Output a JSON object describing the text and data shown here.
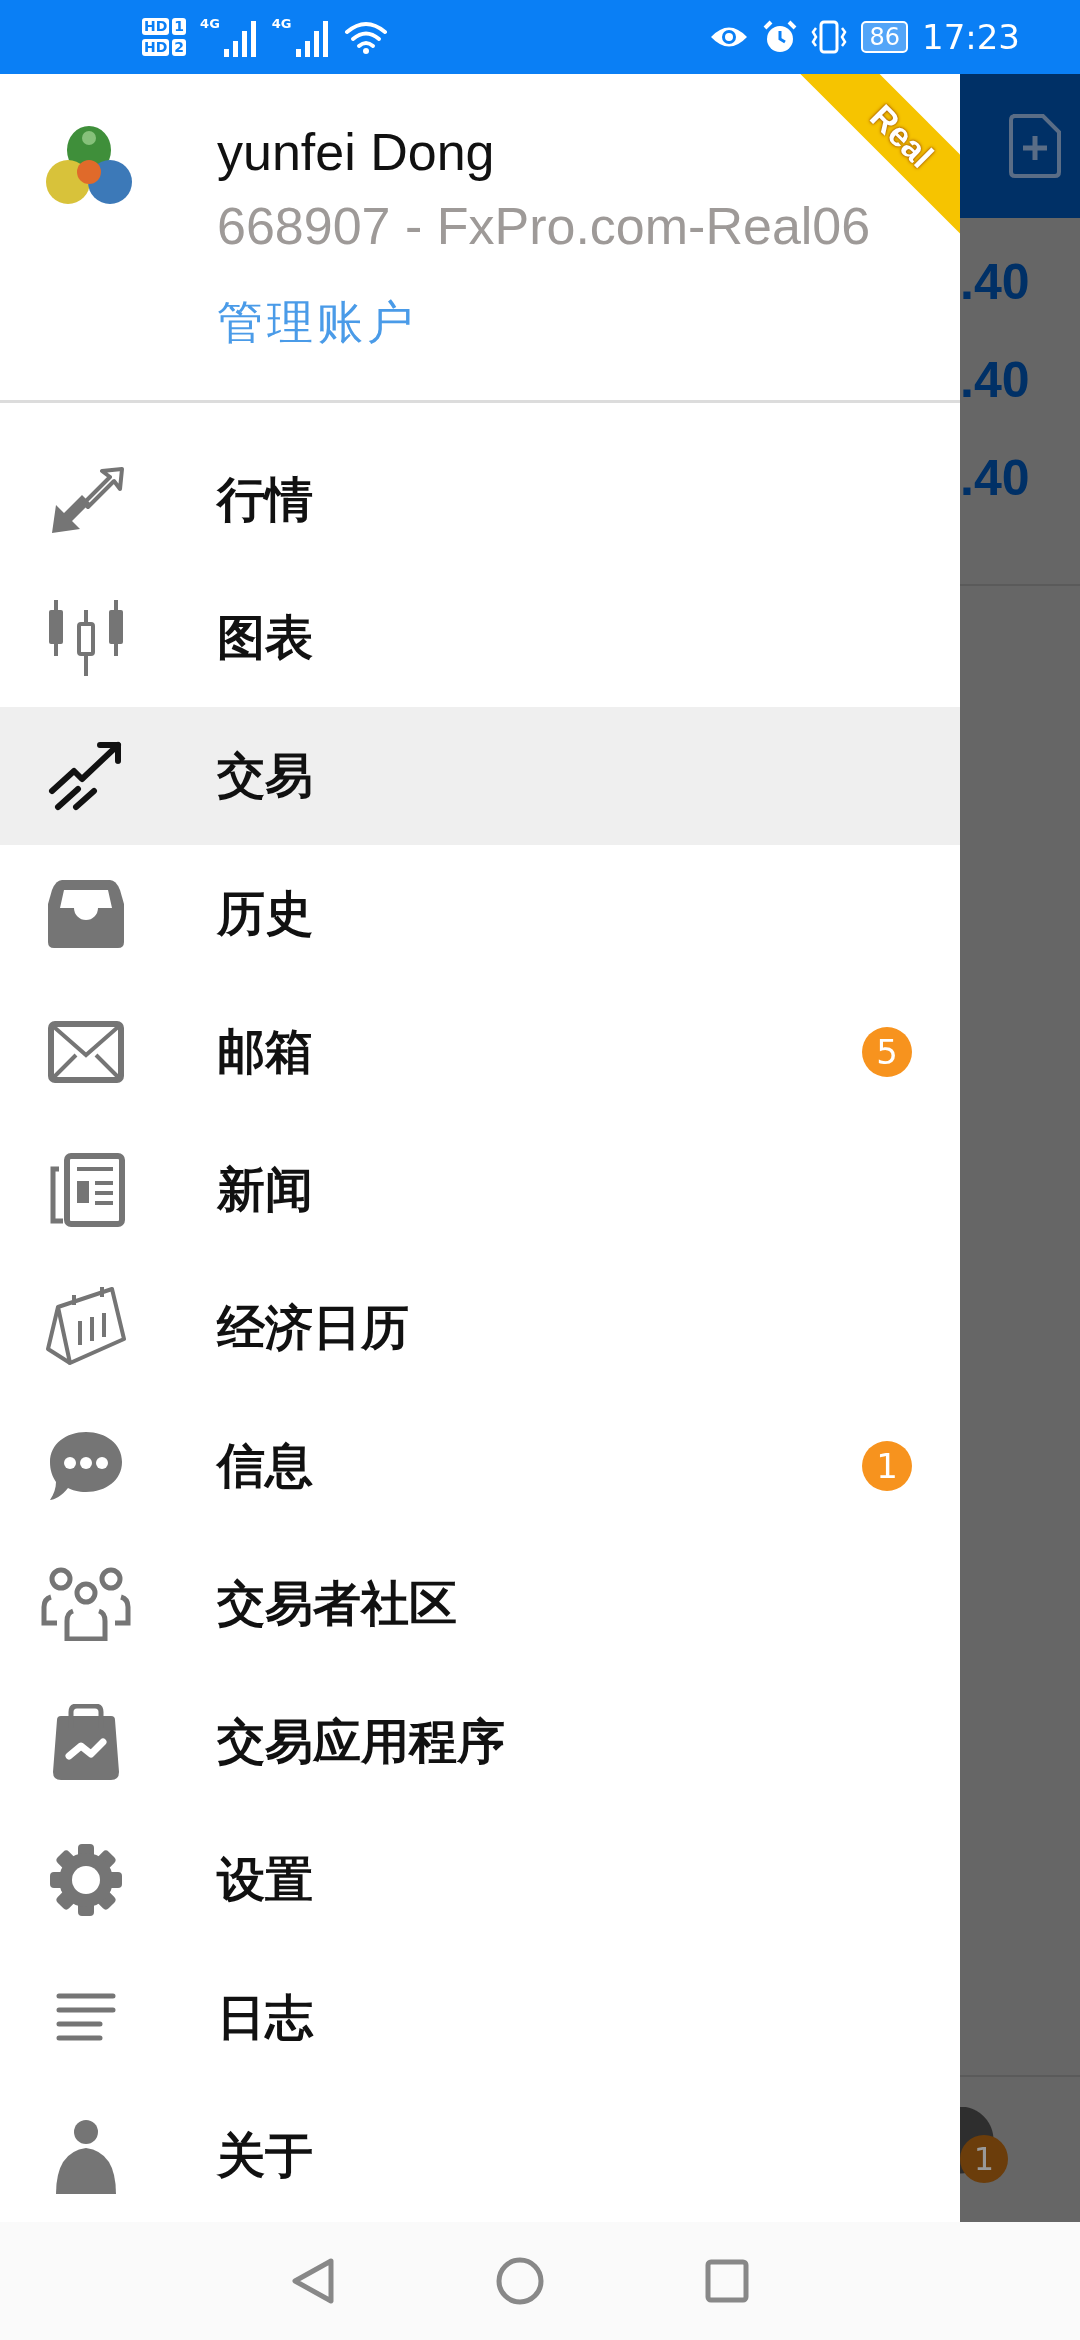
{
  "status_bar": {
    "sims": [
      {
        "label": "HD",
        "slot": "1"
      },
      {
        "label": "HD",
        "slot": "2"
      }
    ],
    "networks": [
      "4G",
      "4G"
    ],
    "battery": "86",
    "time": "17:23"
  },
  "drawer": {
    "ribbon": "Real",
    "account": {
      "name": "yunfei Dong",
      "number": "668907 - FxPro.com-Real06",
      "manage_link": "管理账户"
    },
    "items": [
      {
        "label": "行情",
        "selected": false
      },
      {
        "label": "图表",
        "selected": false
      },
      {
        "label": "交易",
        "selected": true
      },
      {
        "label": "历史",
        "selected": false
      },
      {
        "label": "邮箱",
        "selected": false,
        "badge": "5"
      },
      {
        "label": "新闻",
        "selected": false
      },
      {
        "label": "经济日历",
        "selected": false
      },
      {
        "label": "信息",
        "selected": false,
        "badge": "1"
      },
      {
        "label": "交易者社区",
        "selected": false
      },
      {
        "label": "交易应用程序",
        "selected": false
      },
      {
        "label": "设置",
        "selected": false
      },
      {
        "label": "日志",
        "selected": false
      },
      {
        "label": "关于",
        "selected": false
      }
    ]
  },
  "background": {
    "prices": [
      ".40",
      ".40",
      ".40"
    ],
    "badge": "1"
  }
}
